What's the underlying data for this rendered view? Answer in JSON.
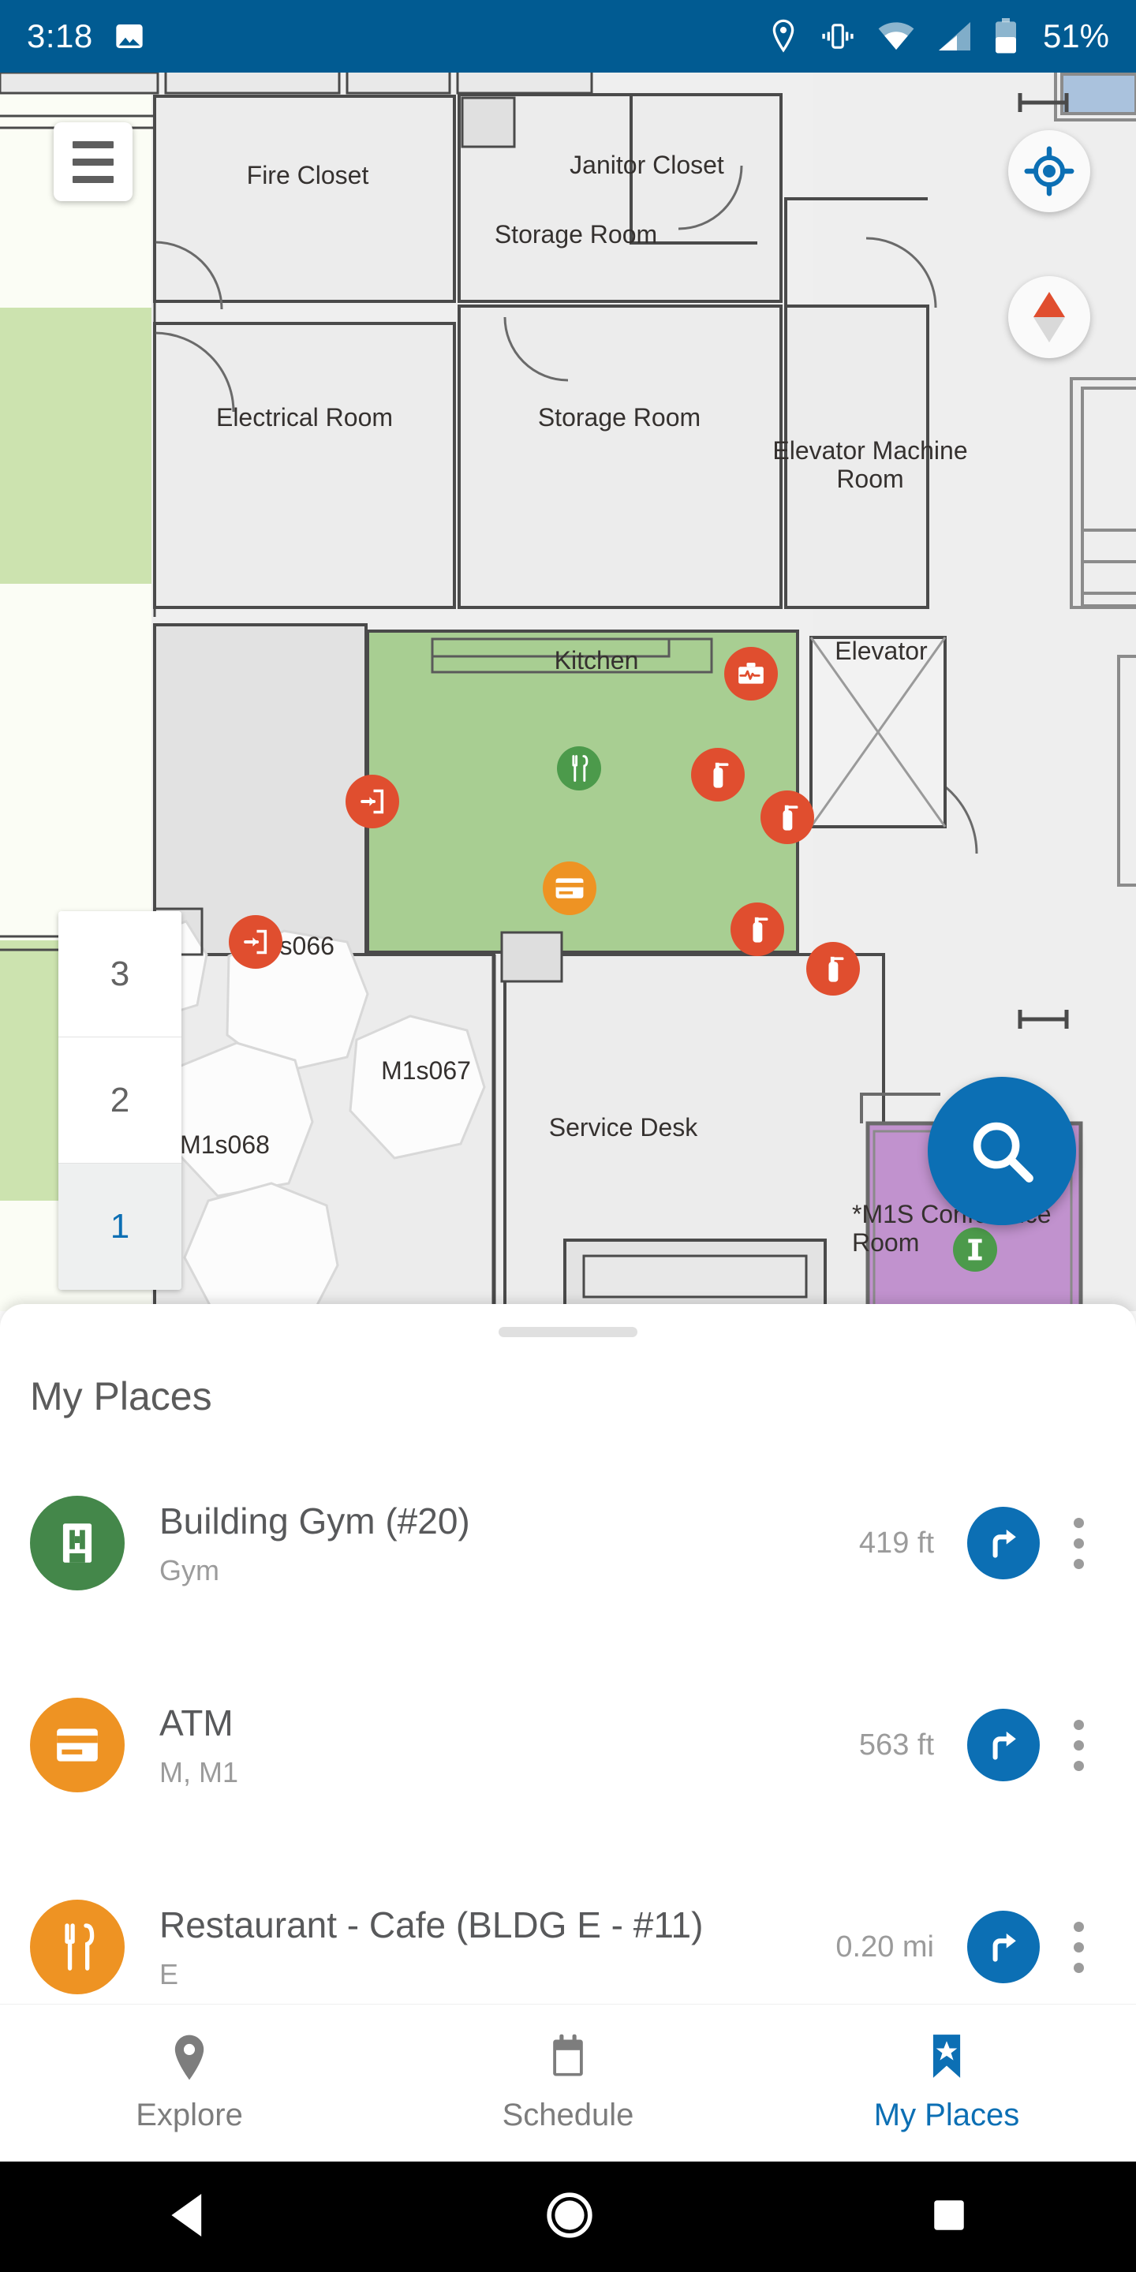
{
  "status_bar": {
    "time": "3:18",
    "battery_percent": "51%",
    "icons": [
      "image-icon",
      "location-icon",
      "vibrate-icon",
      "wifi-icon",
      "cell-signal-icon",
      "battery-icon"
    ],
    "background_color": "#015B92"
  },
  "map": {
    "menu_button_label": "",
    "locate_button_label": "",
    "compass_button_label": "",
    "search_fab_label": "",
    "floor_selector": {
      "floors": [
        "3",
        "2",
        "1"
      ],
      "selected": "1"
    },
    "room_labels": [
      "Fire Closet",
      "Janitor Closet",
      "Storage Room",
      "Electrical Room",
      "Storage Room",
      "Elevator Machine Room",
      "Kitchen",
      "Elevator",
      "M1s066",
      "M1s067",
      "M1s068",
      "Service Desk",
      "*M1S Conference Room"
    ],
    "pois": [
      {
        "name": "first-aid-kit-marker",
        "kind": "aed"
      },
      {
        "name": "fire-extinguisher-marker",
        "kind": "extinguisher"
      },
      {
        "name": "fire-extinguisher-marker",
        "kind": "extinguisher"
      },
      {
        "name": "fire-extinguisher-marker",
        "kind": "extinguisher"
      },
      {
        "name": "fire-extinguisher-marker",
        "kind": "extinguisher"
      },
      {
        "name": "exit-marker",
        "kind": "exit"
      },
      {
        "name": "exit-marker",
        "kind": "exit"
      },
      {
        "name": "atm-marker",
        "kind": "atm"
      },
      {
        "name": "restaurant-marker",
        "kind": "restaurant"
      },
      {
        "name": "info-marker",
        "kind": "info"
      }
    ],
    "colors": {
      "poi_red": "#E04E2F",
      "poi_orange": "#EE9323",
      "poi_green": "#4C9A4B",
      "kitchen_fill": "#A8CE92",
      "conference_fill": "#C192CE",
      "outdoor_green": "#CCE3AF",
      "accent_blue": "#0C6FB4"
    }
  },
  "sheet": {
    "title": "My Places",
    "places": [
      {
        "name": "Building Gym (#20)",
        "subtitle": "Gym",
        "distance": "419 ft",
        "icon": "gym-building-icon",
        "icon_color": "green"
      },
      {
        "name": "ATM",
        "subtitle": "M, M1",
        "distance": "563 ft",
        "icon": "atm-card-icon",
        "icon_color": "orange"
      },
      {
        "name": "Restaurant - Cafe (BLDG E - #11)",
        "subtitle": "E",
        "distance": "0.20 mi",
        "icon": "restaurant-icon",
        "icon_color": "orange"
      }
    ],
    "row_action_directions": "directions",
    "row_action_more": "more-options"
  },
  "bottom_nav": {
    "items": [
      {
        "label": "Explore",
        "icon": "map-pin-icon",
        "active": false
      },
      {
        "label": "Schedule",
        "icon": "calendar-icon",
        "active": false
      },
      {
        "label": "My Places",
        "icon": "bookmark-star-icon",
        "active": true
      }
    ]
  },
  "android_nav": {
    "back": "back-triangle-icon",
    "home": "home-circle-icon",
    "recents": "recents-square-icon"
  }
}
